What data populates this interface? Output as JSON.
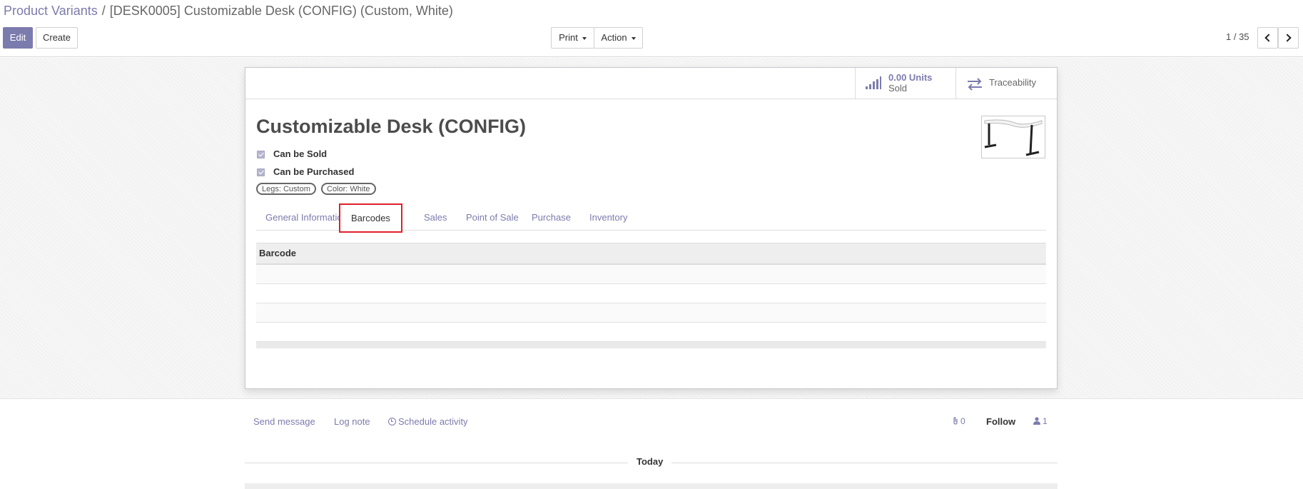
{
  "breadcrumb": {
    "parent": "Product Variants",
    "separator": "/",
    "current": "[DESK0005] Customizable Desk (CONFIG) (Custom, White)"
  },
  "toolbar": {
    "edit_label": "Edit",
    "create_label": "Create",
    "print_label": "Print",
    "action_label": "Action"
  },
  "pager": {
    "value": "1 / 35"
  },
  "stat_buttons": {
    "units_value": "0.00 Units",
    "units_label": "Sold",
    "traceability_label": "Traceability"
  },
  "product": {
    "name": "Customizable Desk (CONFIG)",
    "can_be_sold_label": "Can be Sold",
    "can_be_purchased_label": "Can be Purchased",
    "can_be_sold": true,
    "can_be_purchased": true,
    "tags": [
      "Legs: Custom",
      "Color: White"
    ]
  },
  "tabs": [
    {
      "label": "General Information",
      "active": false
    },
    {
      "label": "Barcodes",
      "active": true
    },
    {
      "label": "Sales",
      "active": false
    },
    {
      "label": "Point of Sale",
      "active": false
    },
    {
      "label": "Purchase",
      "active": false
    },
    {
      "label": "Inventory",
      "active": false
    }
  ],
  "barcodes_table": {
    "columns": [
      "Barcode"
    ],
    "rows": []
  },
  "chatter": {
    "send_message": "Send message",
    "log_note": "Log note",
    "schedule_activity": "Schedule activity",
    "attachments_count": "0",
    "follow_label": "Follow",
    "followers_count": "1",
    "date_separator": "Today"
  },
  "colors": {
    "accent": "#7c7bad",
    "active_tab_outline": "#e0202a"
  }
}
